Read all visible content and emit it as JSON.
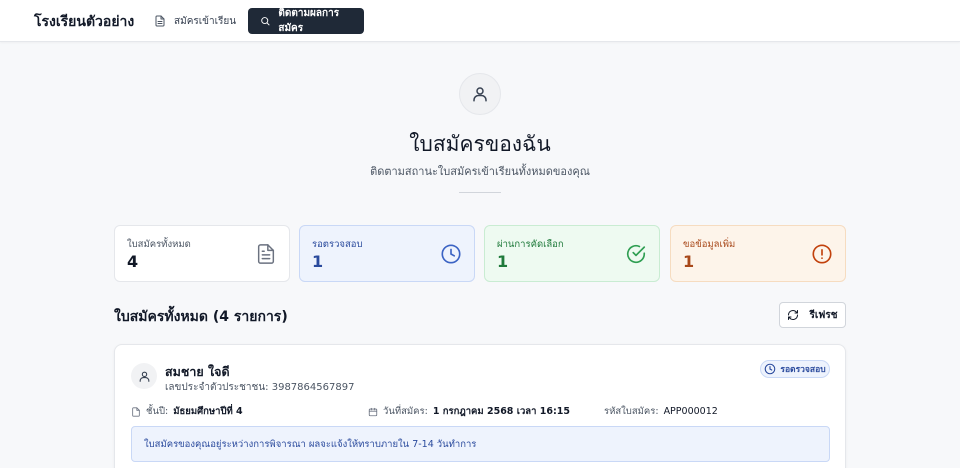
{
  "header": {
    "brand": "โรงเรียนตัวอย่าง",
    "nav_apply": "สมัครเข้าเรียน",
    "nav_track": "ติดตามผลการสมัคร"
  },
  "hero": {
    "title": "ใบสมัครของฉัน",
    "subtitle": "ติดตามสถานะใบสมัครเข้าเรียนทั้งหมดของคุณ"
  },
  "stats": {
    "total": {
      "label": "ใบสมัครทั้งหมด",
      "value": "4"
    },
    "pending": {
      "label": "รอตรวจสอบ",
      "value": "1"
    },
    "passed": {
      "label": "ผ่านการคัดเลือก",
      "value": "1"
    },
    "info": {
      "label": "ขอข้อมูลเพิ่ม",
      "value": "1"
    }
  },
  "list": {
    "title": "ใบสมัครทั้งหมด (4 รายการ)",
    "refresh_label": "รีเฟรช"
  },
  "application": {
    "name": "สมชาย ใจดี",
    "id_line": "เลขประจำตัวประชาชน: 3987864567897",
    "status": "รอตรวจสอบ",
    "grade_label": "ชั้นปี:",
    "grade_value": "มัธยมศึกษาปีที่ 4",
    "date_label": "วันที่สมัคร:",
    "date_value": "1 กรกฎาคม 2568 เวลา 16:15",
    "code_label": "รหัสใบสมัคร:",
    "code_value": "APP000012",
    "note": "ใบสมัครของคุณอยู่ระหว่างการพิจารณา ผลจะแจ้งให้ทราบภายใน 7-14 วันทำการ"
  },
  "icons": {
    "apply": "document-icon",
    "track": "search-icon",
    "hero": "user-icon",
    "total": "document-icon",
    "pending": "clock-icon",
    "passed": "check-circle-icon",
    "info": "alert-circle-icon",
    "refresh": "refresh-icon"
  },
  "colors": {
    "dark": "#1f2937",
    "pending": "#2a4a9d",
    "passed": "#1f7a3b",
    "info": "#a8481a"
  }
}
